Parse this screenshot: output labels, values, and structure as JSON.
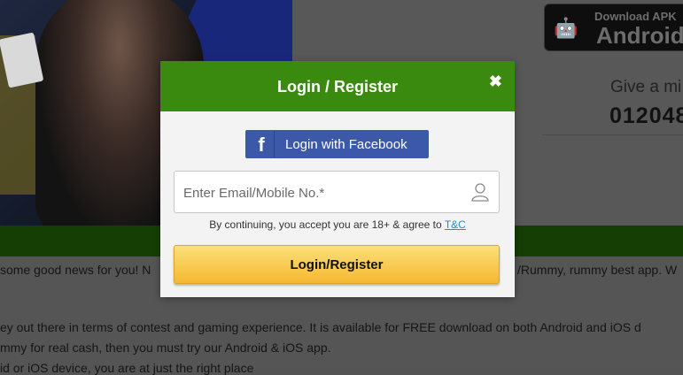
{
  "background": {
    "apk_badge": {
      "line1": "Download APK",
      "line2": "Android"
    },
    "give_text": "Give a mi",
    "phone_text": "012048",
    "body_lines": [
      "some good news for you! N",
      "/Rummy, rummy best app. W",
      "ey out there in terms of contest and gaming experience. It is available for FREE download on both Android and iOS d",
      "mmy for real cash, then you must try our Android & iOS app.",
      "id or iOS device, you are at just the right place"
    ]
  },
  "modal": {
    "title": "Login / Register",
    "close_label": "✖",
    "facebook_button": {
      "icon": "f",
      "label": "Login with Facebook"
    },
    "email_input": {
      "placeholder": "Enter Email/Mobile No.*",
      "value": ""
    },
    "terms_text": "By continuing, you accept you are 18+ & agree to ",
    "terms_link": "T&C",
    "submit_label": "Login/Register"
  },
  "colors": {
    "header_green": "#3b8a10",
    "facebook_blue": "#3b59a8",
    "button_yellow": "#f5b831",
    "link_blue": "#1a8fd6"
  }
}
